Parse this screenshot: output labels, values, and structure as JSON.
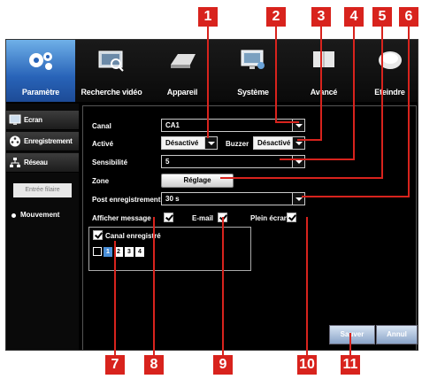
{
  "callouts": [
    "1",
    "2",
    "3",
    "4",
    "5",
    "6",
    "7",
    "8",
    "9",
    "10",
    "11"
  ],
  "top_tabs": [
    {
      "label": "Paramètre",
      "icon": "gears-icon"
    },
    {
      "label": "Recherche vidéo",
      "icon": "video-search-icon"
    },
    {
      "label": "Appareil",
      "icon": "hard-drive-icon"
    },
    {
      "label": "Système",
      "icon": "monitor-icon"
    },
    {
      "label": "Avancé",
      "icon": "advanced-icon"
    },
    {
      "label": "Eteindre",
      "icon": "power-icon"
    }
  ],
  "sidebar": {
    "items": [
      {
        "label": "Ecran",
        "icon": "screen-icon"
      },
      {
        "label": "Enregistrement",
        "icon": "film-reel-icon"
      },
      {
        "label": "Réseau",
        "icon": "network-icon"
      }
    ],
    "sub_item": "Entrée filaire",
    "selected": "Mouvement"
  },
  "form": {
    "canal_label": "Canal",
    "canal_value": "CA1",
    "active_label": "Activé",
    "active_value": "Désactivé",
    "buzzer_label": "Buzzer",
    "buzzer_value": "Désactivé",
    "sensibilite_label": "Sensibilité",
    "sensibilite_value": "5",
    "zone_label": "Zone",
    "zone_button": "Réglage",
    "post_label": "Post enregistrement",
    "post_value": "30 s",
    "afficher_label": "Afficher message",
    "email_label": "E-mail",
    "plein_label": "Plein écran",
    "canal_enreg_label": "Canal enregistré",
    "channels": [
      "1",
      "2",
      "3",
      "4"
    ]
  },
  "buttons": {
    "save": "Sauver",
    "cancel": "Annul"
  },
  "colors": {
    "callout": "#d8231d",
    "active_tab": "#2863b8",
    "background": "#000000"
  }
}
